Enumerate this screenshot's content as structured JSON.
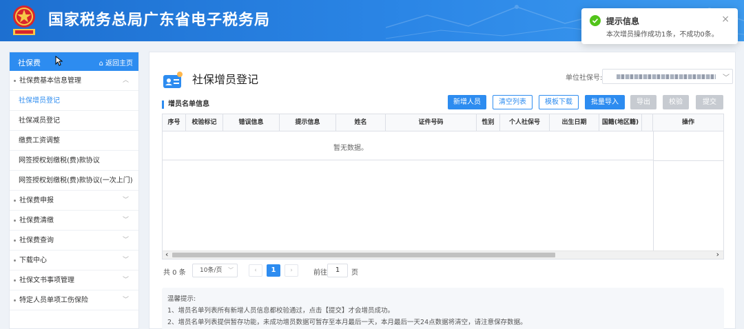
{
  "header": {
    "site_title": "国家税务总局广东省电子税务局"
  },
  "toast": {
    "title": "提示信息",
    "message": "本次增员操作成功1条，不成功0条。",
    "close": "×"
  },
  "sidebar": {
    "title": "社保费",
    "home_link": "返回主页",
    "items": [
      {
        "label": "社保费基本信息管理",
        "type": "group",
        "state": "expanded"
      },
      {
        "label": "社保增员登记",
        "type": "sub",
        "active": true
      },
      {
        "label": "社保减员登记",
        "type": "sub"
      },
      {
        "label": "缴费工资调整",
        "type": "sub"
      },
      {
        "label": "网签授权划缴税(费)款协议",
        "type": "sub"
      },
      {
        "label": "网签授权划缴税(费)款协议(一次上门)",
        "type": "sub"
      },
      {
        "label": "社保费申报",
        "type": "group"
      },
      {
        "label": "社保费清缴",
        "type": "group"
      },
      {
        "label": "社保费查询",
        "type": "group"
      },
      {
        "label": "下载中心",
        "type": "group"
      },
      {
        "label": "社保文书事项管理",
        "type": "group"
      },
      {
        "label": "特定人员单项工伤保险",
        "type": "group"
      }
    ]
  },
  "main": {
    "page_title": "社保增员登记",
    "unit_label": "单位社保号:",
    "section_title": "增员名单信息",
    "buttons": {
      "add": "新增人员",
      "clear": "清空列表",
      "template": "模板下载",
      "import": "批量导入",
      "export": "导出",
      "verify": "校验",
      "submit": "提交"
    },
    "table": {
      "columns": [
        "序号",
        "校验标记",
        "错误信息",
        "提示信息",
        "姓名",
        "证件号码",
        "性别",
        "个人社保号",
        "出生日期",
        "国籍(地区籍)",
        "操作"
      ],
      "empty_text": "暂无数据。"
    },
    "pagination": {
      "total": "共 0 条",
      "page_size": "10条/页",
      "current_page": "1",
      "goto_label": "前往",
      "goto_value": "1",
      "page_unit": "页"
    },
    "tips": [
      "温馨提示:",
      "1、增员名单列表所有新增人员信息都校验通过，点击【提交】才会增员成功。",
      "2、增员名单列表提供暂存功能，未成功增员数据可暂存至本月最后一天，本月最后一天24点数据将清空，请注意保存数据。"
    ]
  },
  "colors": {
    "header_blue": "#1d6fd0",
    "accent": "#2d8cf0",
    "success": "#52c41a",
    "disabled": "#c7cbd1"
  },
  "icons": [
    "national-emblem-icon",
    "check-circle-icon",
    "close-icon",
    "cursor-icon",
    "home-icon",
    "chevron-up-icon",
    "chevron-down-icon",
    "id-card-icon",
    "caret-down-icon",
    "arrow-left-icon",
    "arrow-right-icon"
  ]
}
